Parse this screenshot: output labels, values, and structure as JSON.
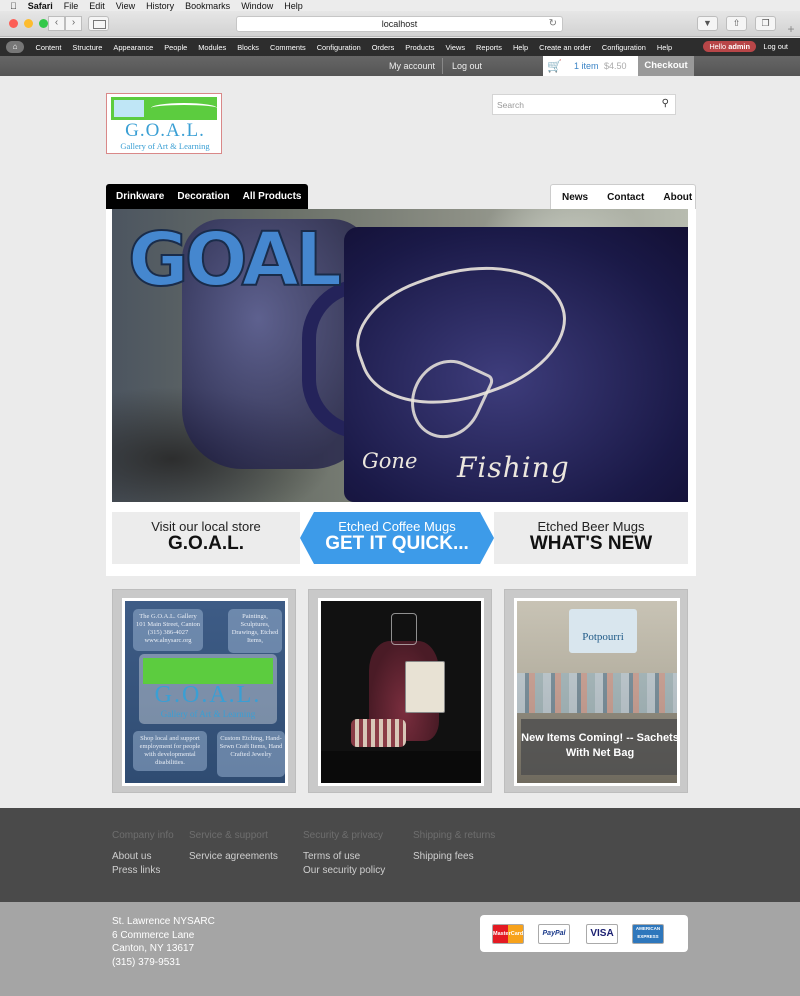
{
  "macos": {
    "menu": [
      "Safari",
      "File",
      "Edit",
      "View",
      "History",
      "Bookmarks",
      "Window",
      "Help"
    ]
  },
  "browser": {
    "url": "localhost"
  },
  "admin_toolbar": {
    "items": [
      "Content",
      "Structure",
      "Appearance",
      "People",
      "Modules",
      "Blocks",
      "Comments",
      "Configuration",
      "Orders",
      "Products",
      "Views",
      "Reports",
      "Help",
      "Create an order",
      "Configuration",
      "Help"
    ],
    "hello_prefix": "Hello",
    "hello_user": "admin",
    "logout": "Log out"
  },
  "user_bar": {
    "my_account": "My account",
    "log_out": "Log out",
    "cart_items": "1 item",
    "cart_total": "$4.50",
    "checkout": "Checkout"
  },
  "site": {
    "logo_name": "G.O.A.L.",
    "logo_sub": "Gallery of Art & Learning",
    "search_placeholder": "Search"
  },
  "main_nav": [
    "Drinkware",
    "Decoration",
    "All Products"
  ],
  "secondary_nav": [
    "News",
    "Contact",
    "About"
  ],
  "hero": {
    "title": "GOAL",
    "mug_text_1": "Gone",
    "mug_text_2": "Fishing"
  },
  "promos": [
    {
      "line1": "Visit our local store",
      "line2": "G.O.A.L."
    },
    {
      "line1": "Etched Coffee Mugs",
      "line2": "GET IT QUICK..."
    },
    {
      "line1": "Etched Beer Mugs",
      "line2": "WHAT'S NEW"
    }
  ],
  "tiles": {
    "tile1": {
      "box1": "The G.O.A.L. Gallery 101 Main Street, Canton (315) 386-4027 www.alnysarc.org",
      "box2": "Paintings, Sculptures, Drawings, Etched Items,",
      "box3": "Shop local and support employment for people with developmental disabilities.",
      "box4": "Custom Etching, Hand-Sewn Craft Items, Hand Crafted Jewelry",
      "logo_name": "G.O.A.L.",
      "logo_sub": "Gallery of Art & Learning"
    },
    "tile3": {
      "sign": "Potpourri",
      "overlay": "New Items Coming! -- Sachets With Net Bag"
    }
  },
  "footer": {
    "columns": [
      {
        "heading": "Company info",
        "links": [
          "About us",
          "Press links"
        ]
      },
      {
        "heading": "Service & support",
        "links": [
          "Service agreements"
        ]
      },
      {
        "heading": "Security & privacy",
        "links": [
          "Terms of use",
          "Our security policy"
        ]
      },
      {
        "heading": "Shipping & returns",
        "links": [
          "Shipping fees"
        ]
      }
    ],
    "address": [
      "St. Lawrence NYSARC",
      "6 Commerce Lane",
      "Canton, NY 13617",
      "(315) 379-9531"
    ],
    "payment_cards": [
      "MasterCard",
      "PayPal",
      "VISA",
      "AMERICAN EXPRESS"
    ]
  }
}
